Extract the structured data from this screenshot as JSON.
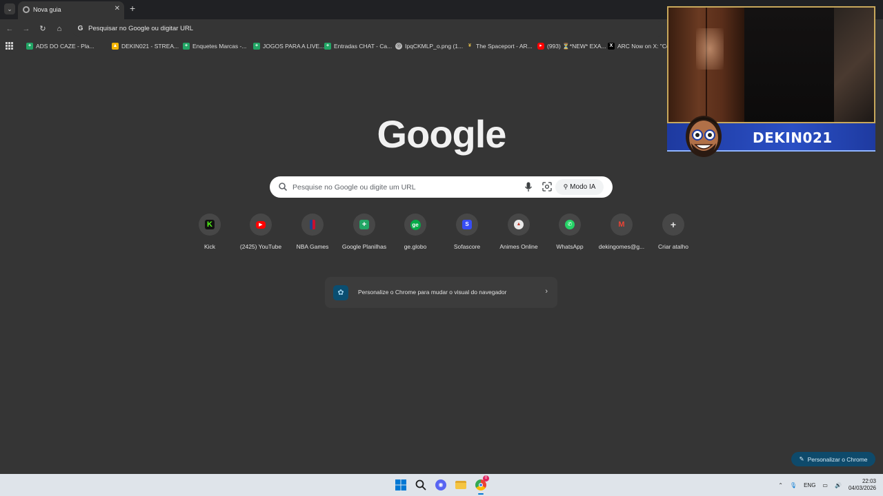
{
  "tab": {
    "title": "Nova guia"
  },
  "omnibox": {
    "text": "Pesquisar no Google ou digitar URL"
  },
  "bookmarks": [
    {
      "label": "ADS DO CAZE - Pla...",
      "icon": "sheets-icon",
      "color": "#22a565"
    },
    {
      "label": "DEKIN021 - STREA...",
      "icon": "drive-icon",
      "color": "#f4b400"
    },
    {
      "label": "Enquetes Marcas -...",
      "icon": "sheets-icon",
      "color": "#22a565"
    },
    {
      "label": "JOGOS PARA A LIVE...",
      "icon": "sheets-icon",
      "color": "#22a565"
    },
    {
      "label": "Entradas CHAT - Ca...",
      "icon": "sheets-icon",
      "color": "#22a565"
    },
    {
      "label": "IpqCKMLP_o.png (1...",
      "icon": "globe-icon",
      "color": "#bdbdbd"
    },
    {
      "label": "The Spaceport - AR...",
      "icon": "spaceport-icon",
      "color": "#e8c14a"
    },
    {
      "label": "(993) ⏳*NEW* EXA...",
      "icon": "youtube-icon",
      "color": "#ff0000"
    },
    {
      "label": "ARC Now on X: \"Co...",
      "icon": "x-icon",
      "color": "#000000"
    }
  ],
  "logo": {
    "text": "Google"
  },
  "search": {
    "placeholder": "Pesquise no Google ou digite um URL",
    "ai_mode_label": "Modo IA"
  },
  "shortcuts": [
    {
      "label": "Kick",
      "icon": "kick-icon",
      "glyph": "K",
      "color": "#53fc18",
      "fg": "#000000"
    },
    {
      "label": "(2425) YouTube",
      "icon": "youtube-icon",
      "glyph": "▶",
      "color": "#ff0000",
      "fg": "#ffffff"
    },
    {
      "label": "NBA Games",
      "icon": "nba-icon",
      "glyph": "",
      "color": "#1d428a",
      "fg": "#ffffff"
    },
    {
      "label": "Google Planilhas",
      "icon": "sheets-icon",
      "glyph": "+",
      "color": "#22a565",
      "fg": "#ffffff"
    },
    {
      "label": "ge.globo",
      "icon": "ge-icon",
      "glyph": "ge",
      "color": "#06aa48",
      "fg": "#ffffff"
    },
    {
      "label": "Sofascore",
      "icon": "sofascore-icon",
      "glyph": "S",
      "color": "#374df5",
      "fg": "#ffffff"
    },
    {
      "label": "Animes Online",
      "icon": "animes-icon",
      "glyph": "▲",
      "color": "#c0392b",
      "fg": "#ffffff"
    },
    {
      "label": "WhatsApp",
      "icon": "whatsapp-icon",
      "glyph": "✆",
      "color": "#25d366",
      "fg": "#ffffff"
    },
    {
      "label": "dekingomes@g...",
      "icon": "gmail-icon",
      "glyph": "M",
      "color": "#ffffff",
      "fg": "#ea4335"
    },
    {
      "label": "Criar atalho",
      "icon": "plus-icon",
      "glyph": "+",
      "color": "#474747",
      "fg": "#e3e3e3"
    }
  ],
  "customize_card": {
    "text": "Personalize o Chrome para mudar o visual do navegador"
  },
  "customize_button": {
    "label": "Personalizar o Chrome"
  },
  "webcam": {
    "banner_text": "DEKIN021"
  },
  "taskbar": {
    "language": "ENG",
    "time": "22:03",
    "date": "04/03/2026",
    "chrome_badge": "0"
  }
}
